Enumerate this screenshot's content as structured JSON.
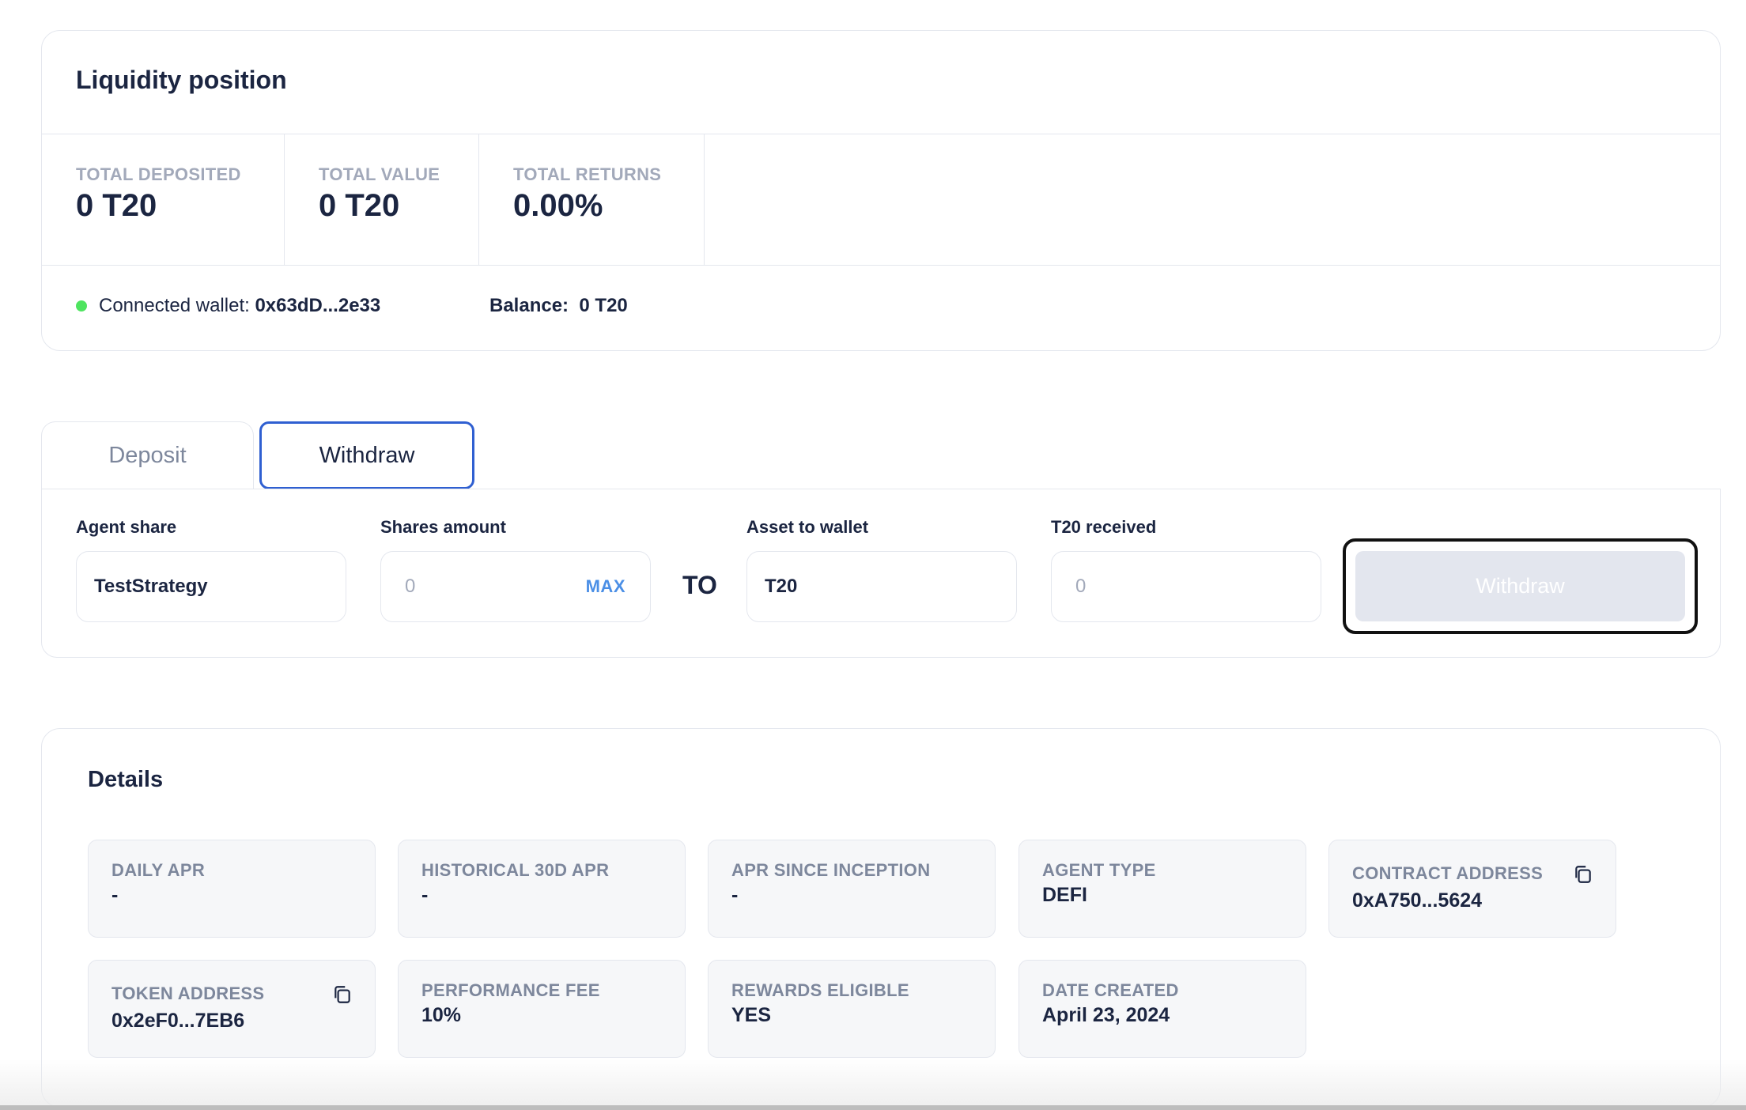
{
  "liquidity": {
    "title": "Liquidity position",
    "stats": [
      {
        "label": "TOTAL DEPOSITED",
        "value": "0 T20"
      },
      {
        "label": "TOTAL VALUE",
        "value": "0 T20"
      },
      {
        "label": "TOTAL RETURNS",
        "value": "0.00%"
      }
    ],
    "wallet_label": "Connected wallet:",
    "wallet_address": "0x63dD...2e33",
    "balance_label": "Balance:",
    "balance_value": "0 T20",
    "status_color": "#4ee45f"
  },
  "tabs": [
    {
      "label": "Deposit",
      "active": false
    },
    {
      "label": "Withdraw",
      "active": true
    }
  ],
  "form": {
    "agent_share": {
      "label": "Agent share",
      "value": "TestStrategy"
    },
    "shares_amount": {
      "label": "Shares amount",
      "placeholder": "0",
      "max_label": "MAX"
    },
    "to_label": "TO",
    "asset_to_wallet": {
      "label": "Asset to wallet",
      "value": "T20"
    },
    "t20_received": {
      "label": "T20 received",
      "placeholder": "0"
    },
    "submit_label": "Withdraw"
  },
  "details": {
    "title": "Details",
    "tiles": [
      {
        "label": "DAILY APR",
        "value": "-"
      },
      {
        "label": "HISTORICAL 30D APR",
        "value": "-"
      },
      {
        "label": "APR SINCE INCEPTION",
        "value": "-"
      },
      {
        "label": "AGENT TYPE",
        "value": "DEFI"
      },
      {
        "label": "CONTRACT ADDRESS",
        "value": "0xA750...5624",
        "icon": "copy-icon"
      },
      {
        "label": "TOKEN ADDRESS",
        "value": "0x2eF0...7EB6",
        "icon": "copy-icon"
      },
      {
        "label": "PERFORMANCE FEE",
        "value": "10%"
      },
      {
        "label": "REWARDS ELIGIBLE",
        "value": "YES"
      },
      {
        "label": "DATE CREATED",
        "value": "April 23, 2024"
      }
    ]
  },
  "colors": {
    "accent": "#2f5fd1",
    "link": "#4b8fe6",
    "text": "#1b2541",
    "muted": "#a2a9ba",
    "disabled_button": "#e3e6ee"
  }
}
